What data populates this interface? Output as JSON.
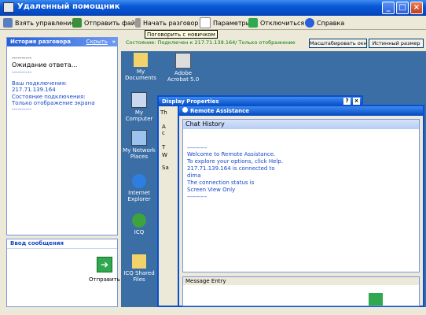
{
  "window": {
    "title": "Удаленный помощник"
  },
  "toolbar": {
    "items": [
      {
        "label": "Взять управление",
        "icon": "take-control-icon"
      },
      {
        "label": "Отправить файл",
        "icon": "send-file-icon"
      },
      {
        "label": "Начать разговор",
        "icon": "start-talk-icon"
      },
      {
        "label": "Параметры",
        "icon": "settings-icon"
      },
      {
        "label": "Отключиться",
        "icon": "disconnect-icon"
      },
      {
        "label": "Справка",
        "icon": "help-icon"
      }
    ],
    "tooltip": "Поговорить с новичком"
  },
  "history": {
    "title": "История разговора",
    "hide_link": "Скрыть",
    "lines": [
      "----------",
      "Ожидание ответа...",
      "----------",
      "Ваш подключения:",
      "217.71.139.164",
      "Состояние подключения:",
      "Только отображение экрана",
      "----------"
    ]
  },
  "message_entry": {
    "title": "Ввод сообщения",
    "send_label": "Отправить"
  },
  "status": {
    "text": "Состояние: Подключен к 217.71.139.164/ Только отображение",
    "scale_button": "Масштабировать окно",
    "actual_size_button": "Истинный размер"
  },
  "desktop": {
    "icons": [
      {
        "label": "My Documents"
      },
      {
        "label": "Adobe Acrobat 5.0"
      },
      {
        "label": "My Computer"
      },
      {
        "label": "My Network Places"
      },
      {
        "label": "Internet Explorer"
      },
      {
        "label": "ICQ"
      },
      {
        "label": "ICQ Shared Files"
      }
    ]
  },
  "display_properties": {
    "title": "Display Properties",
    "tab_letter": "Th",
    "letters": [
      "A",
      "c",
      "T",
      "W",
      "Sa"
    ]
  },
  "remote_assistance": {
    "title": "Remote Assistance",
    "chat_history_title": "Chat History",
    "lines": [
      "----------",
      "Welcome to Remote Assistance.",
      "To explore your options, click Help.",
      "217.71.139.164 is connected to",
      "dima",
      "The connection status is",
      "Screen View Only",
      "----------"
    ],
    "message_entry_title": "Message Entry"
  }
}
